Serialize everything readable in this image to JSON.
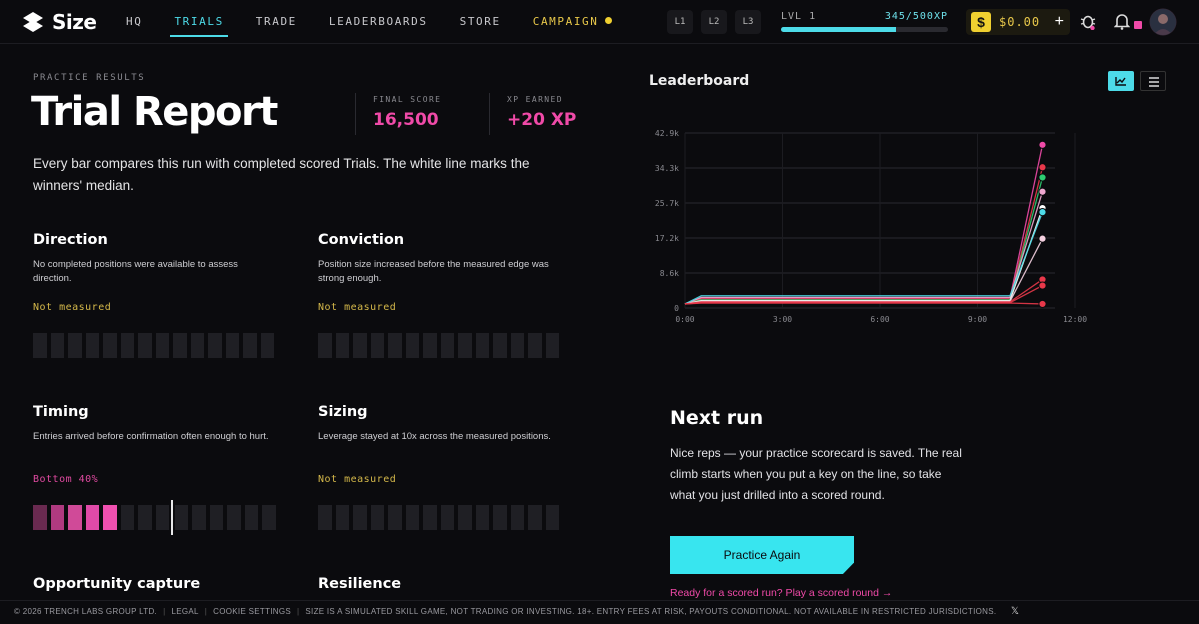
{
  "app": {
    "name": "Size"
  },
  "nav": {
    "items": [
      {
        "label": "HQ"
      },
      {
        "label": "TRIALS"
      },
      {
        "label": "TRADE"
      },
      {
        "label": "LEADERBOARDS"
      },
      {
        "label": "STORE"
      },
      {
        "label": "CAMPAIGN"
      }
    ],
    "active": "TRIALS"
  },
  "topbar": {
    "level_buttons": [
      "L1",
      "L2",
      "L3"
    ],
    "level_label": "LVL 1",
    "xp_text": "345/500XP",
    "xp_progress": 0.69,
    "wallet_icon": "$",
    "wallet_amount": "$0.00",
    "wallet_plus": "+",
    "icons": [
      "bug-icon",
      "bell-icon",
      "avatar"
    ]
  },
  "report": {
    "kicker": "PRACTICE RESULTS",
    "title": "Trial Report",
    "final_score_label": "FINAL SCORE",
    "final_score": "16,500",
    "xp_label": "XP EARNED",
    "xp_earned": "+20 XP",
    "intro": "Every bar compares this run with completed scored Trials. The white line marks the winners' median."
  },
  "metrics": [
    {
      "title": "Direction",
      "desc": "No completed positions were available to assess direction.",
      "status": "Not measured",
      "status_color": "#d4b84a",
      "filled": 0,
      "median_index": null
    },
    {
      "title": "Conviction",
      "desc": "Position size increased before the measured edge was strong enough.",
      "status": "Not measured",
      "status_color": "#d4b84a",
      "filled": 0,
      "median_index": null
    },
    {
      "title": "Timing",
      "desc": "Entries arrived before confirmation often enough to hurt.",
      "status": "Bottom 40%",
      "status_color": "#e04aa0",
      "filled": 5,
      "median_index": 8
    },
    {
      "title": "Sizing",
      "desc": "Leverage stayed at 10x across the measured positions.",
      "status": "Not measured",
      "status_color": "#d4b84a",
      "filled": 0,
      "median_index": null
    },
    {
      "title": "Opportunity capture",
      "desc": "",
      "status": "",
      "status_color": "#d4b84a",
      "filled": 0,
      "median_index": null
    },
    {
      "title": "Resilience",
      "desc": "",
      "status": "",
      "status_color": "#d4b84a",
      "filled": 0,
      "median_index": null
    }
  ],
  "leaderboard": {
    "title": "Leaderboard",
    "views": [
      "chart-icon",
      "list-icon"
    ],
    "active_view": "chart-icon"
  },
  "chart_data": {
    "type": "line",
    "title": "",
    "x_ticks": [
      "0:00",
      "3:00",
      "6:00",
      "9:00",
      "12:00"
    ],
    "y_ticks": [
      "0",
      "8.6k",
      "17.2k",
      "25.7k",
      "34.3k",
      "42.9k"
    ],
    "x_range_minutes": [
      0,
      720
    ],
    "y_range": [
      0,
      42900
    ],
    "grid": true,
    "series": [
      {
        "color": "#f04aa8",
        "values": [
          [
            0,
            1000
          ],
          [
            30,
            2400
          ],
          [
            600,
            2400
          ],
          [
            660,
            40000
          ]
        ]
      },
      {
        "color": "#e8384a",
        "values": [
          [
            0,
            1000
          ],
          [
            30,
            2200
          ],
          [
            600,
            2200
          ],
          [
            660,
            34500
          ]
        ]
      },
      {
        "color": "#2ecc71",
        "values": [
          [
            0,
            1000
          ],
          [
            30,
            2000
          ],
          [
            600,
            2000
          ],
          [
            660,
            32000
          ]
        ]
      },
      {
        "color": "#f0a8d0",
        "values": [
          [
            0,
            1000
          ],
          [
            30,
            2600
          ],
          [
            600,
            2600
          ],
          [
            660,
            28500
          ]
        ]
      },
      {
        "color": "#ffffff",
        "values": [
          [
            0,
            1000
          ],
          [
            30,
            1800
          ],
          [
            600,
            1800
          ],
          [
            660,
            24500
          ]
        ]
      },
      {
        "color": "#4ddbe8",
        "values": [
          [
            0,
            1000
          ],
          [
            30,
            3000
          ],
          [
            600,
            3000
          ],
          [
            660,
            23500
          ]
        ]
      },
      {
        "color": "#f4d0e0",
        "values": [
          [
            0,
            1000
          ],
          [
            30,
            1600
          ],
          [
            600,
            1600
          ],
          [
            660,
            17000
          ]
        ]
      },
      {
        "color": "#e8384a",
        "values": [
          [
            0,
            1000
          ],
          [
            30,
            1500
          ],
          [
            600,
            1500
          ],
          [
            660,
            7000
          ]
        ]
      },
      {
        "color": "#e8384a",
        "values": [
          [
            0,
            1000
          ],
          [
            30,
            1300
          ],
          [
            600,
            1300
          ],
          [
            660,
            5500
          ]
        ]
      },
      {
        "color": "#e8384a",
        "values": [
          [
            0,
            1000
          ],
          [
            30,
            1200
          ],
          [
            600,
            1200
          ],
          [
            660,
            1000
          ]
        ]
      }
    ]
  },
  "next_run": {
    "title": "Next run",
    "body": "Nice reps — your practice scorecard is saved. The real climb starts when you put a key on the line, so take what you just drilled into a scored round.",
    "button": "Practice Again",
    "link": "Ready for a scored run? Play a scored round →"
  },
  "footer": {
    "items": [
      "© 2026 TRENCH LABS GROUP LTD.",
      "LEGAL",
      "COOKIE SETTINGS",
      "SIZE IS A SIMULATED SKILL GAME, NOT TRADING OR INVESTING. 18+. ENTRY FEES AT RISK, PAYOUTS CONDITIONAL. NOT AVAILABLE IN RESTRICTED JURISDICTIONS."
    ],
    "social_icon": "x-icon"
  }
}
